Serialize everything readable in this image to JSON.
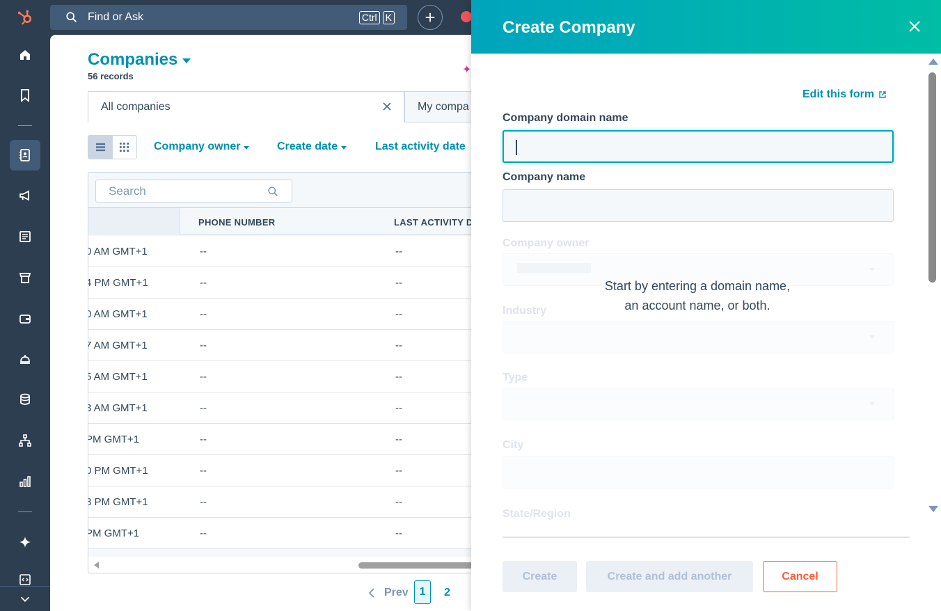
{
  "topbar": {
    "search_placeholder": "Find or Ask",
    "shortcut_keys": [
      "Ctrl",
      "K"
    ]
  },
  "page": {
    "title": "Companies",
    "record_count": "56 records"
  },
  "views": [
    {
      "label": "All companies"
    },
    {
      "label": "My compa"
    }
  ],
  "filters": [
    "Company owner",
    "Create date",
    "Last activity date"
  ],
  "table": {
    "search_placeholder": "Search",
    "columns": [
      "PHONE NUMBER",
      "LAST ACTIVITY D"
    ],
    "rows": [
      {
        "time": "0 AM GMT+1",
        "phone": "--",
        "last": "--"
      },
      {
        "time": "4 PM GMT+1",
        "phone": "--",
        "last": "--"
      },
      {
        "time": "0 AM GMT+1",
        "phone": "--",
        "last": "--"
      },
      {
        "time": "7 AM GMT+1",
        "phone": "--",
        "last": "--"
      },
      {
        "time": "5 AM GMT+1",
        "phone": "--",
        "last": "--"
      },
      {
        "time": "3 AM GMT+1",
        "phone": "--",
        "last": "--"
      },
      {
        "time": " PM GMT+1",
        "phone": "--",
        "last": "--"
      },
      {
        "time": "0 PM GMT+1",
        "phone": "--",
        "last": "--"
      },
      {
        "time": "8 PM GMT+1",
        "phone": "--",
        "last": "--"
      },
      {
        "time": " PM GMT+1",
        "phone": "--",
        "last": "--"
      }
    ]
  },
  "pagination": {
    "prev": "Prev",
    "pages": [
      "1",
      "2"
    ],
    "current": "1"
  },
  "panel": {
    "title": "Create Company",
    "edit_link": "Edit this form",
    "fields": {
      "domain": {
        "label": "Company domain name",
        "value": ""
      },
      "name": {
        "label": "Company name",
        "value": ""
      },
      "owner": {
        "label": "Company owner"
      },
      "industry": {
        "label": "Industry"
      },
      "type": {
        "label": "Type"
      },
      "city": {
        "label": "City"
      },
      "state": {
        "label": "State/Region"
      }
    },
    "helper_line1": "Start by entering a domain name,",
    "helper_line2": "an account name, or both.",
    "buttons": {
      "create": "Create",
      "create_another": "Create and add another",
      "cancel": "Cancel"
    }
  },
  "colors": {
    "accent": "#0091ae",
    "header_gradient_start": "#00a4bd",
    "header_gradient_end": "#00bda5",
    "cancel": "#ff5c35",
    "nav_bg": "#2d3e50"
  }
}
